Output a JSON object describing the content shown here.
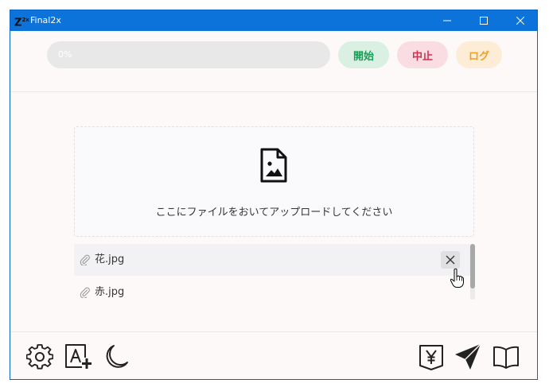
{
  "window": {
    "title": "Final2x",
    "logo_char": "Z"
  },
  "toolbar": {
    "progress_text": "0%",
    "start_label": "開始",
    "stop_label": "中止",
    "log_label": "ログ"
  },
  "dropzone": {
    "instruction": "ここにファイルをおいてアップロードしてください"
  },
  "files": [
    {
      "name": "花.jpg"
    },
    {
      "name": "赤.jpg"
    }
  ],
  "colors": {
    "titlebar": "#0b73d9",
    "start": "#18a058",
    "stop": "#d03050",
    "log": "#f0a020"
  },
  "footer_icons": [
    "gear-icon",
    "font-add-icon",
    "moon-icon",
    "yen-icon",
    "send-icon",
    "book-icon"
  ]
}
